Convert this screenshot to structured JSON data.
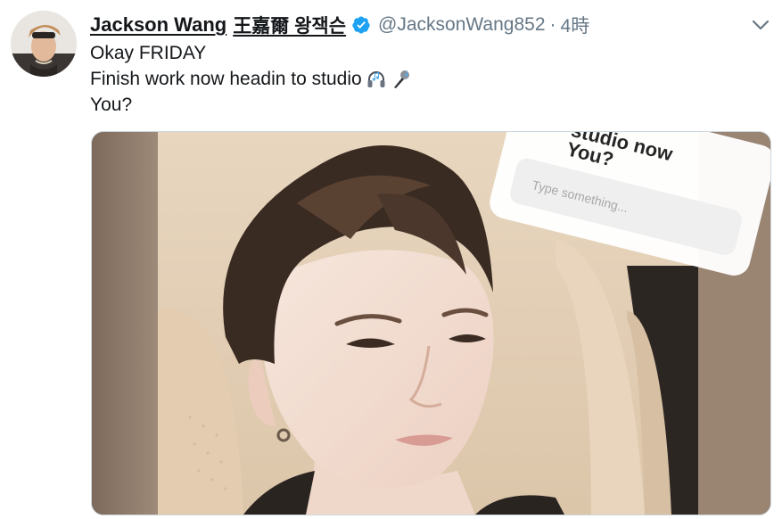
{
  "user": {
    "display_name": "Jackson Wang",
    "cjk_name": "王嘉爾 왕잭슨",
    "handle": "@JacksonWang852",
    "separator": "·",
    "timestamp": "4時",
    "verified_icon": "verified-badge-icon",
    "avatar_icon": "avatar"
  },
  "tweet": {
    "lines": [
      "Okay FRIDAY",
      "Finish work now headin to studio",
      "You?"
    ],
    "emojis": [
      "headphones-icon",
      "microphone-icon"
    ]
  },
  "media": {
    "sticker_question": "studio now\nYou?",
    "sticker_line1": "studio now",
    "sticker_line2": "You?",
    "sticker_placeholder": "Type something..."
  },
  "colors": {
    "text": "#14171a",
    "muted": "#657786",
    "verified": "#1da1f2",
    "border": "#ccd6dd"
  }
}
